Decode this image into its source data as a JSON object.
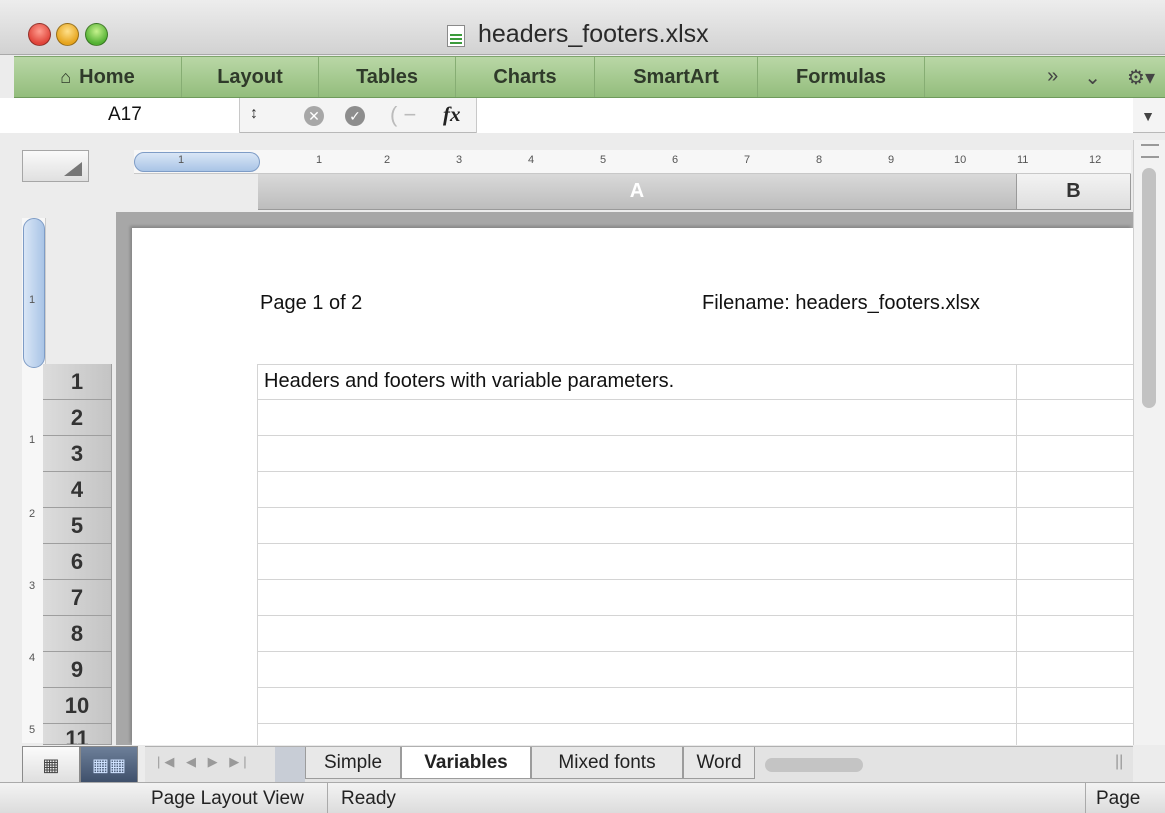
{
  "window": {
    "title": "headers_footers.xlsx"
  },
  "ribbon": {
    "tabs": [
      {
        "label": "Home"
      },
      {
        "label": "Layout"
      },
      {
        "label": "Tables"
      },
      {
        "label": "Charts"
      },
      {
        "label": "SmartArt"
      },
      {
        "label": "Formulas"
      }
    ],
    "overflow_icon": "chevron-double-right-icon",
    "collapse_icon": "chevron-down-icon",
    "settings_icon": "gear-icon"
  },
  "formula_bar": {
    "name_box": "A17",
    "fx_label": "fx",
    "formula": ""
  },
  "ruler": {
    "h_ticks": [
      "1",
      "1",
      "2",
      "3",
      "4",
      "5",
      "6",
      "7",
      "8",
      "9",
      "10",
      "11",
      "12"
    ],
    "v_ticks": [
      "1",
      "1",
      "2",
      "3",
      "4",
      "5"
    ]
  },
  "columns": [
    "A",
    "B"
  ],
  "page_header": {
    "left": "Page 1 of 2",
    "right": "Filename: headers_footers.xlsx"
  },
  "rows": [
    {
      "num": "1",
      "a": "Headers and footers with variable parameters."
    },
    {
      "num": "2",
      "a": ""
    },
    {
      "num": "3",
      "a": ""
    },
    {
      "num": "4",
      "a": ""
    },
    {
      "num": "5",
      "a": ""
    },
    {
      "num": "6",
      "a": ""
    },
    {
      "num": "7",
      "a": ""
    },
    {
      "num": "8",
      "a": ""
    },
    {
      "num": "9",
      "a": ""
    },
    {
      "num": "10",
      "a": ""
    },
    {
      "num": "11",
      "a": ""
    }
  ],
  "sheet_tabs": [
    {
      "label": "Simple",
      "active": false
    },
    {
      "label": "Variables",
      "active": true
    },
    {
      "label": "Mixed fonts",
      "active": false
    },
    {
      "label": "Word",
      "active": false
    }
  ],
  "status": {
    "view": "Page Layout View",
    "state": "Ready",
    "right": "Page"
  }
}
